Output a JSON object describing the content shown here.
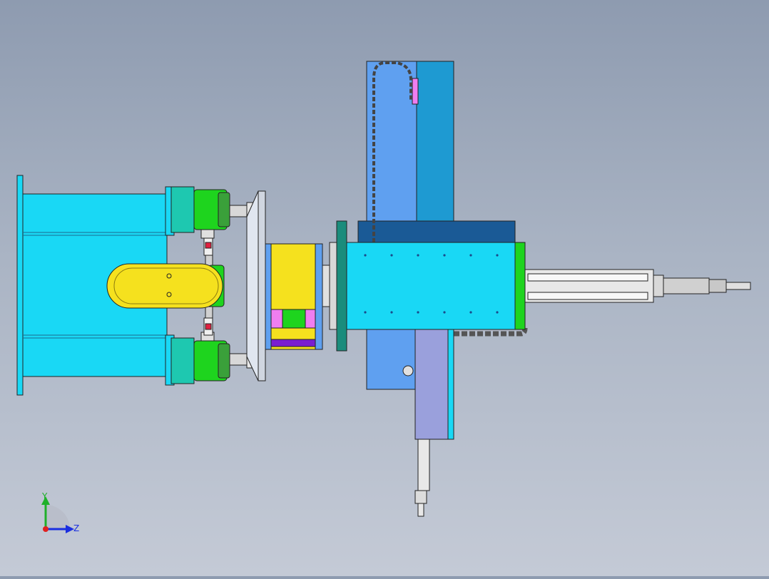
{
  "viewport": {
    "background_top": "#8e9bb0",
    "background_bottom": "#c4cad6"
  },
  "triad": {
    "y_label": "Y",
    "z_label": "Z",
    "colors": {
      "y": "#1fb02a",
      "z": "#1a2ee0",
      "x": "#e02020"
    }
  },
  "palette": {
    "cyan": "#19d8f5",
    "blue": "#5fa0f0",
    "steel_blue": "#1e9ad2",
    "navy": "#1a5a96",
    "green": "#1ed41e",
    "yellow": "#f5e11e",
    "lavender": "#9aa0dc",
    "teal": "#1a8c7c",
    "silver": "#d8d8d8",
    "dark_chain": "#505050",
    "pink": "#f07ef0",
    "purple": "#7a1ed0"
  }
}
